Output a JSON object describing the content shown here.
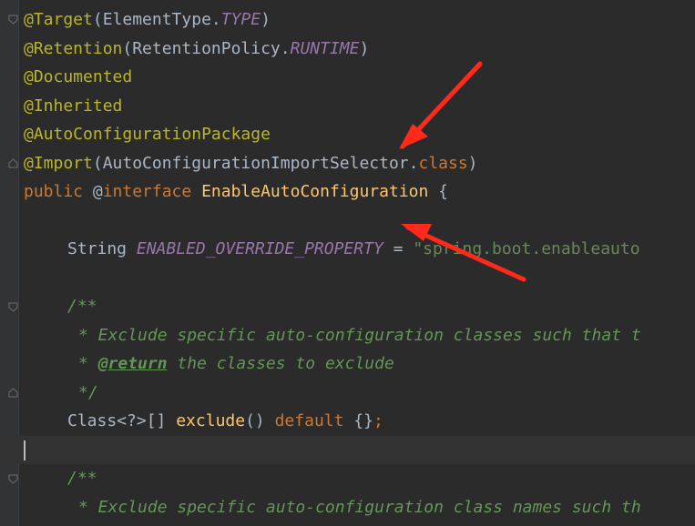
{
  "colors": {
    "background": "#2b2b2b",
    "gutter": "#313335",
    "annotation": "#bbb529",
    "keyword": "#cc7832",
    "field": "#9876aa",
    "method": "#ffc66d",
    "string": "#6a8759",
    "comment": "#629755",
    "arrow": "#ff2a1a"
  },
  "code": {
    "l1": {
      "at": "@Target",
      "open": "(",
      "type": "ElementType.",
      "const": "TYPE",
      "close": ")"
    },
    "l2": {
      "at": "@Retention",
      "open": "(",
      "type": "RetentionPolicy.",
      "const": "RUNTIME",
      "close": ")"
    },
    "l3": {
      "at": "@Documented"
    },
    "l4": {
      "at": "@Inherited"
    },
    "l5": {
      "at": "@AutoConfigurationPackage"
    },
    "l6": {
      "at": "@Import",
      "open": "(",
      "type": "AutoConfigurationImportSelector.",
      "kw": "class",
      "close": ")"
    },
    "l7": {
      "kw1": "public ",
      "at": "@",
      "kw2": "interface ",
      "name": "EnableAutoConfiguration",
      "rest": " {"
    },
    "l9": {
      "type": "String ",
      "field": "ENABLED_OVERRIDE_PROPERTY",
      "eq": " = ",
      "str": "\"spring.boot.enableauto"
    },
    "l11": {
      "text": "/**"
    },
    "l12": {
      "text": "* Exclude specific auto-configuration classes such that t"
    },
    "l13": {
      "star": "* ",
      "tag": "@return",
      "text": " the classes to exclude"
    },
    "l14": {
      "text": "*/"
    },
    "l15": {
      "type": "Class<?>[] ",
      "method": "exclude",
      "parens": "() ",
      "kw": "default",
      "braces": " {}",
      "semi": ";"
    },
    "l17": {
      "text": "/**"
    },
    "l18": {
      "text": "* Exclude specific auto-configuration class names such th"
    }
  },
  "icons": {
    "fold_start": "fold-start-icon",
    "fold_end": "fold-end-icon",
    "arrow": "red-arrow-icon"
  }
}
